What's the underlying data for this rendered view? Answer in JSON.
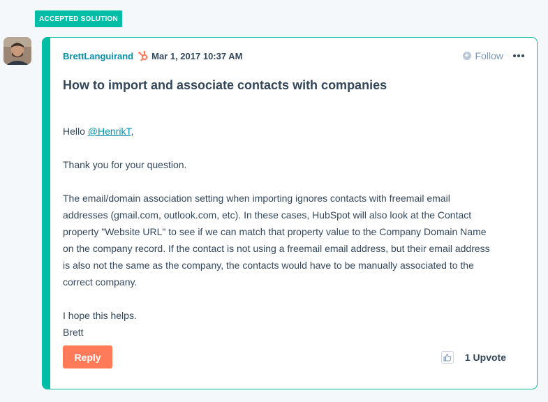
{
  "badge": {
    "label": "ACCEPTED SOLUTION"
  },
  "post": {
    "author": "BrettLanguirand",
    "date": "Mar 1, 2017 10:37 AM",
    "follow_label": "Follow",
    "title": "How to import and associate contacts with companies",
    "greeting_prefix": "Hello ",
    "mention": "@HenrikT",
    "greeting_suffix": ",",
    "paragraph_1": "Thank you for your question.",
    "paragraph_2_lines": [
      "The email/domain association setting when importing ignores contacts with freemail email",
      "addresses (gmail.com, outlook.com, etc). In these cases, HubSpot will also look at the Contact",
      "property \"Website URL\" to see if we can match that property value to the Company Domain Name",
      "on the company record.  If the contact is not using a freemail email address, but their email address",
      "is also not the same as the company, the contacts would have to be manually associated to the",
      "correct company."
    ],
    "closing_line_1": "I hope this helps.",
    "closing_line_2": "Brett",
    "reply_label": "Reply",
    "upvote_label": "1 Upvote"
  },
  "icons": {
    "avatar": "user-avatar",
    "author_badge": "hubspot-sprocket-icon",
    "follow": "plus-circle-icon",
    "more": "ellipsis-icon",
    "upvote": "thumbs-up-icon"
  },
  "colors": {
    "accent": "#00bda5",
    "link": "#0091ae",
    "reply_button": "#ff7a59",
    "text": "#33475b",
    "muted": "#7c98b6",
    "page_bg": "#f5f8fa"
  }
}
